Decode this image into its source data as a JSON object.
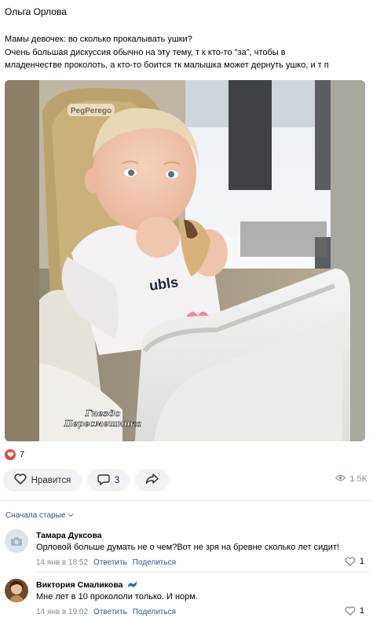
{
  "post": {
    "author": "Ольга Орлова",
    "text_lines": [
      "Мамы девочек: во сколько прокалывать ушки?",
      "Очень большая дискуссия обычно на эту тему, т к кто-то \"за\", чтобы в",
      "младенчестве проколоть, а кто-то боится тк малышка может дернуть ушко, и т п"
    ],
    "image": {
      "chair_brand": "PegPerego",
      "watermark_line1": "Гнездо",
      "watermark_line2": "Пересмешника"
    },
    "reactions": {
      "icon": "heart-icon",
      "count": "7"
    },
    "actions": {
      "like_label": "Нравится",
      "comments_count": "3",
      "views": "1.5K"
    }
  },
  "comments_section": {
    "sort_label": "Сначала старые"
  },
  "comments": [
    {
      "author": "Тамара Дуксова",
      "text": "Орловой больше думать не о чем?Вот не зря на бревне сколько лет сидит!",
      "time": "14 янв в 18:52",
      "reply": "Ответить",
      "share": "Поделиться",
      "likes": "1"
    },
    {
      "author": "Виктория Смаликова",
      "text": "Мне лет в 10 прокололи только. И норм.",
      "time": "14 янв в 19:02",
      "reply": "Ответить",
      "share": "Поделиться",
      "likes": "1"
    }
  ],
  "colors": {
    "link": "#2a5885",
    "meta": "#818c99",
    "button_bg": "#f0f2f5",
    "heart": "#e64646"
  }
}
